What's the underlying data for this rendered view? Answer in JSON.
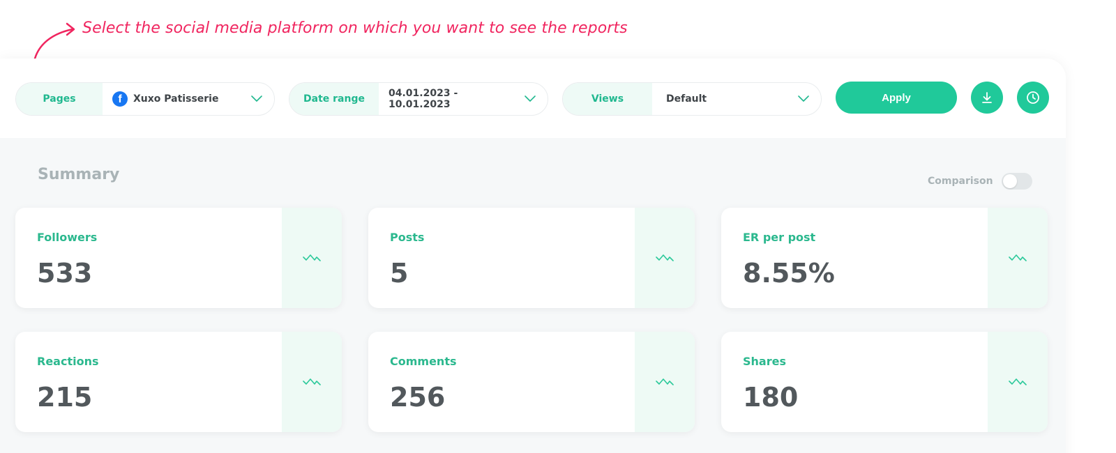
{
  "annotation": {
    "text": "Select the social media platform on which you want to see the reports"
  },
  "filters": {
    "pages": {
      "label": "Pages",
      "value": "Xuxo Patisserie",
      "platform_icon": "facebook-icon"
    },
    "date_range": {
      "label": "Date range",
      "value": "04.01.2023 - 10.01.2023"
    },
    "views": {
      "label": "Views",
      "value": "Default"
    }
  },
  "toolbar": {
    "apply_label": "Apply",
    "download_icon": "download-icon",
    "history_icon": "clock-icon"
  },
  "summary": {
    "title": "Summary",
    "comparison_label": "Comparison",
    "comparison_enabled": false,
    "cards": [
      {
        "label": "Followers",
        "value": "533"
      },
      {
        "label": "Posts",
        "value": "5"
      },
      {
        "label": "ER per post",
        "value": "8.55%"
      },
      {
        "label": "Reactions",
        "value": "215"
      },
      {
        "label": "Comments",
        "value": "256"
      },
      {
        "label": "Shares",
        "value": "180"
      }
    ]
  },
  "colors": {
    "accent": "#20c99a",
    "annotation": "#f0255f",
    "facebook": "#1877f2"
  }
}
